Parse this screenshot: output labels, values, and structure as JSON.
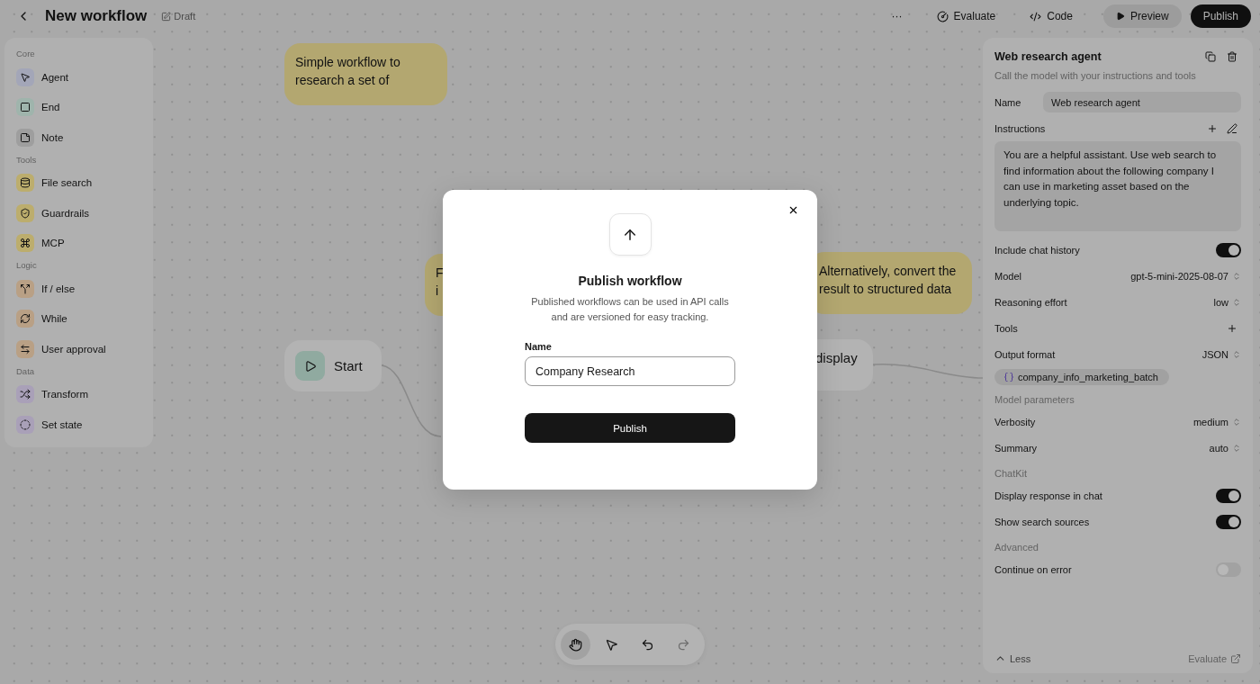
{
  "header": {
    "title": "New workflow",
    "status": "Draft",
    "actions": [
      {
        "kind": "more",
        "label": "···"
      },
      {
        "kind": "evaluate",
        "label": "Evaluate"
      },
      {
        "kind": "code",
        "label": "Code"
      },
      {
        "kind": "preview",
        "label": "Preview"
      },
      {
        "kind": "publish",
        "label": "Publish"
      }
    ]
  },
  "palette": [
    {
      "title": "Core",
      "items": [
        {
          "label": "Agent",
          "kind": "agent",
          "color": "#a3a6b8"
        },
        {
          "label": "End",
          "kind": "end",
          "color": "#9fb4ac"
        },
        {
          "label": "Note",
          "kind": "note",
          "color": "#9e9e9e"
        }
      ]
    },
    {
      "title": "Tools",
      "items": [
        {
          "label": "File search",
          "kind": "file",
          "color": "#bcad6d"
        },
        {
          "label": "Guardrails",
          "kind": "guard",
          "color": "#bcad6d"
        },
        {
          "label": "MCP",
          "kind": "mcp",
          "color": "#bcad6d"
        }
      ]
    },
    {
      "title": "Logic",
      "items": [
        {
          "label": "If / else",
          "kind": "branch",
          "color": "#b9a085"
        },
        {
          "label": "While",
          "kind": "loop",
          "color": "#b9a085"
        },
        {
          "label": "User approval",
          "kind": "approval",
          "color": "#b9a085"
        }
      ]
    },
    {
      "title": "Data",
      "items": [
        {
          "label": "Transform",
          "kind": "transform",
          "color": "#a9a0b8"
        },
        {
          "label": "Set state",
          "kind": "state",
          "color": "#a9a0b8"
        }
      ]
    }
  ],
  "canvas": {
    "notes": [
      {
        "lines": [
          "Simple workflow to",
          "research a set of"
        ]
      },
      {
        "lines": [
          "F",
          "i"
        ]
      },
      {
        "lines": [
          "Alternatively, convert the",
          "result to structured data"
        ]
      }
    ],
    "nodes": [
      {
        "kind": "start",
        "label": "Start"
      },
      {
        "kind": "plain",
        "label": "display"
      }
    ]
  },
  "inspector": {
    "title": "Web research agent",
    "subtitle": "Call the model with your instructions and tools",
    "name": {
      "label": "Name",
      "value": "Web research agent"
    },
    "instructions": {
      "label": "Instructions",
      "value": "You are a helpful assistant. Use web search to find information about the following company I can use in marketing asset based on the underlying topic."
    },
    "rows": [
      {
        "kind": "toggle",
        "label": "Include chat history",
        "on": true
      },
      {
        "kind": "select",
        "label": "Model",
        "value": "gpt-5-mini-2025-08-07"
      },
      {
        "kind": "select",
        "label": "Reasoning effort",
        "value": "low"
      },
      {
        "kind": "add",
        "label": "Tools"
      },
      {
        "kind": "select",
        "label": "Output format",
        "value": "JSON"
      },
      {
        "kind": "chip",
        "label": "company_info_marketing_batch"
      },
      {
        "kind": "section",
        "label": "Model parameters"
      },
      {
        "kind": "select",
        "label": "Verbosity",
        "value": "medium"
      },
      {
        "kind": "select",
        "label": "Summary",
        "value": "auto"
      },
      {
        "kind": "section",
        "label": "ChatKit"
      },
      {
        "kind": "toggle",
        "label": "Display response in chat",
        "on": true
      },
      {
        "kind": "toggle",
        "label": "Show search sources",
        "on": true
      },
      {
        "kind": "section",
        "label": "Advanced"
      },
      {
        "kind": "toggle",
        "label": "Continue on error",
        "on": false
      }
    ],
    "footer": {
      "less": "Less",
      "evaluate": "Evaluate"
    }
  },
  "toolbar": [
    {
      "kind": "hand",
      "selected": true,
      "disabled": false
    },
    {
      "kind": "pointer",
      "selected": false,
      "disabled": false
    },
    {
      "kind": "undo",
      "selected": false,
      "disabled": false
    },
    {
      "kind": "redo",
      "selected": false,
      "disabled": true
    }
  ],
  "modal": {
    "title": "Publish workflow",
    "description": [
      "Published workflows can be used in API calls",
      "and are versioned for easy tracking."
    ],
    "field_label": "Name",
    "value": "Company Research",
    "button": "Publish"
  }
}
